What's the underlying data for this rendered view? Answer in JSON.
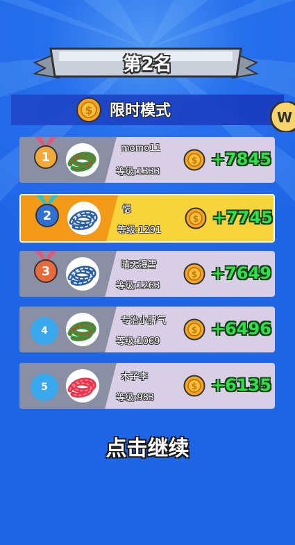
{
  "header": {
    "rank_title": "第2名"
  },
  "mode": {
    "label": "限时模式",
    "coin_icon": "coin-icon"
  },
  "players": [
    {
      "rank": "1",
      "name": "momo11",
      "level": "等级:1333",
      "score": "+7845",
      "medal_color": "#f3a83a",
      "ribbon_color": "#e0587a",
      "snake": "green-red"
    },
    {
      "rank": "2",
      "name": "愢",
      "level": "等级:1291",
      "score": "+7745",
      "medal_color": "#2f6fd6",
      "ribbon_color": "#2cc4c8",
      "snake": "blue-white"
    },
    {
      "rank": "3",
      "name": "晴天漫雪",
      "level": "等级:1263",
      "score": "+7649",
      "medal_color": "#e8693a",
      "ribbon_color": "#e0587a",
      "snake": "blue-white"
    },
    {
      "rank": "4",
      "name": "专治小脾气",
      "level": "等级:1069",
      "score": "+6496",
      "medal_color": "#3aa8ec",
      "ribbon_color": "",
      "snake": "green-red"
    },
    {
      "rank": "5",
      "name": "木子李",
      "level": "等级:983",
      "score": "+6135",
      "medal_color": "#3aa8ec",
      "ribbon_color": "",
      "snake": "red"
    }
  ],
  "footer": {
    "continue_label": "点击继续"
  },
  "colors": {
    "background": "#1f66e6",
    "score_green": "#2ee04a",
    "highlight": "#f7d43a"
  }
}
